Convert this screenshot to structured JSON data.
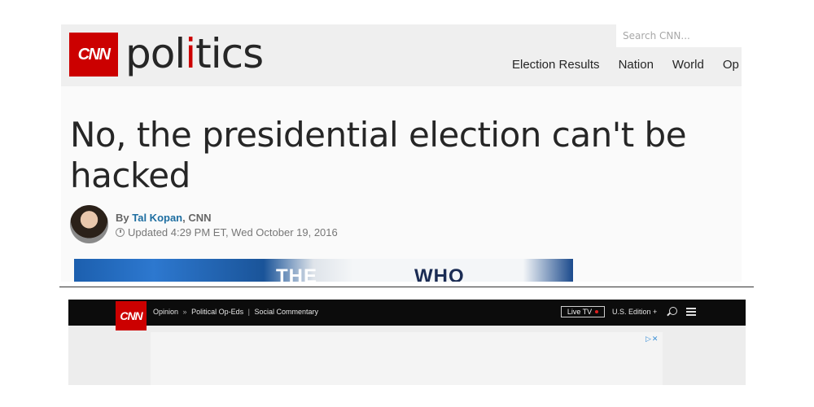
{
  "top_page": {
    "logo_text": "CNN",
    "section_word": [
      "pol",
      "i",
      "tics"
    ],
    "search": {
      "placeholder": "Search CNN..."
    },
    "nav": [
      "Election Results",
      "Nation",
      "World",
      "Op"
    ],
    "headline": "No, the presidential election can't be hacked",
    "byline": {
      "prefix": "By",
      "author": "Tal Kopan",
      "source": ", CNN"
    },
    "updated": "Updated 4:29 PM ET, Wed October 19, 2016",
    "hero_image": {
      "words": [
        "THE",
        "WHO"
      ]
    }
  },
  "bottom_page": {
    "logo_text": "CNN",
    "breadcrumbs": [
      "Opinion",
      "Political Op-Eds",
      "Social Commentary"
    ],
    "crumb_separators": [
      "»",
      "|"
    ],
    "live_tv": "Live TV",
    "edition": "U.S. Edition +",
    "ad_marker": "▷✕"
  },
  "icons": [
    "cnn-logo",
    "clock-icon",
    "live-dot",
    "search-icon",
    "menu-icon",
    "adchoices-icon"
  ],
  "colors": {
    "brand_red": "#cc0000",
    "author_link": "#1e6ea1",
    "nav_dark": "#0c0c0c"
  }
}
